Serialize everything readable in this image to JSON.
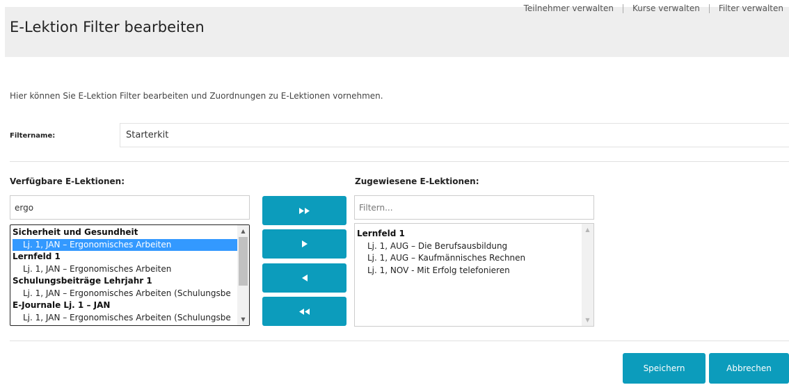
{
  "header": {
    "title": "E-Lektion Filter bearbeiten",
    "nav": [
      "Teilnehmer verwalten",
      "Kurse verwalten",
      "Filter verwalten"
    ]
  },
  "intro": "Hier können Sie E-Lektion Filter bearbeiten und Zuordnungen zu E-Lektionen vornehmen.",
  "filter": {
    "label": "Filtername:",
    "value": "Starterkit"
  },
  "available": {
    "label": "Verfügbare E-Lektionen:",
    "search_value": "ergo",
    "items": [
      {
        "type": "group",
        "text": "Sicherheit und Gesundheit"
      },
      {
        "type": "option",
        "text": "Lj. 1, JAN – Ergonomisches Arbeiten",
        "selected": true
      },
      {
        "type": "group",
        "text": "Lernfeld 1"
      },
      {
        "type": "option",
        "text": "Lj. 1, JAN – Ergonomisches Arbeiten"
      },
      {
        "type": "group",
        "text": "Schulungsbeiträge Lehrjahr 1"
      },
      {
        "type": "option",
        "text": "Lj. 1, JAN – Ergonomisches Arbeiten (Schulungsbe"
      },
      {
        "type": "group",
        "text": "E-Journale Lj. 1 – JAN"
      },
      {
        "type": "option",
        "text": "Lj. 1, JAN – Ergonomisches Arbeiten (Schulungsbe"
      }
    ]
  },
  "assigned": {
    "label": "Zugewiesene E-Lektionen:",
    "search_placeholder": "Filtern...",
    "items": [
      {
        "type": "group",
        "text": "Lernfeld 1"
      },
      {
        "type": "option",
        "text": "Lj. 1, AUG – Die Berufsausbildung"
      },
      {
        "type": "option",
        "text": "Lj. 1, AUG – Kaufmännisches Rechnen"
      },
      {
        "type": "option",
        "text": "Lj. 1, NOV - Mit Erfolg telefonieren"
      }
    ]
  },
  "move_buttons": [
    {
      "name": "move-all-right-button",
      "icon": "double-arrow-right-icon"
    },
    {
      "name": "move-right-button",
      "icon": "arrow-right-icon"
    },
    {
      "name": "move-left-button",
      "icon": "arrow-left-icon"
    },
    {
      "name": "move-all-left-button",
      "icon": "double-arrow-left-icon"
    }
  ],
  "actions": {
    "save": "Speichern",
    "cancel": "Abbrechen"
  },
  "colors": {
    "accent": "#0c9cbc",
    "header_bg": "#eeeeee",
    "selection": "#3399ff"
  }
}
